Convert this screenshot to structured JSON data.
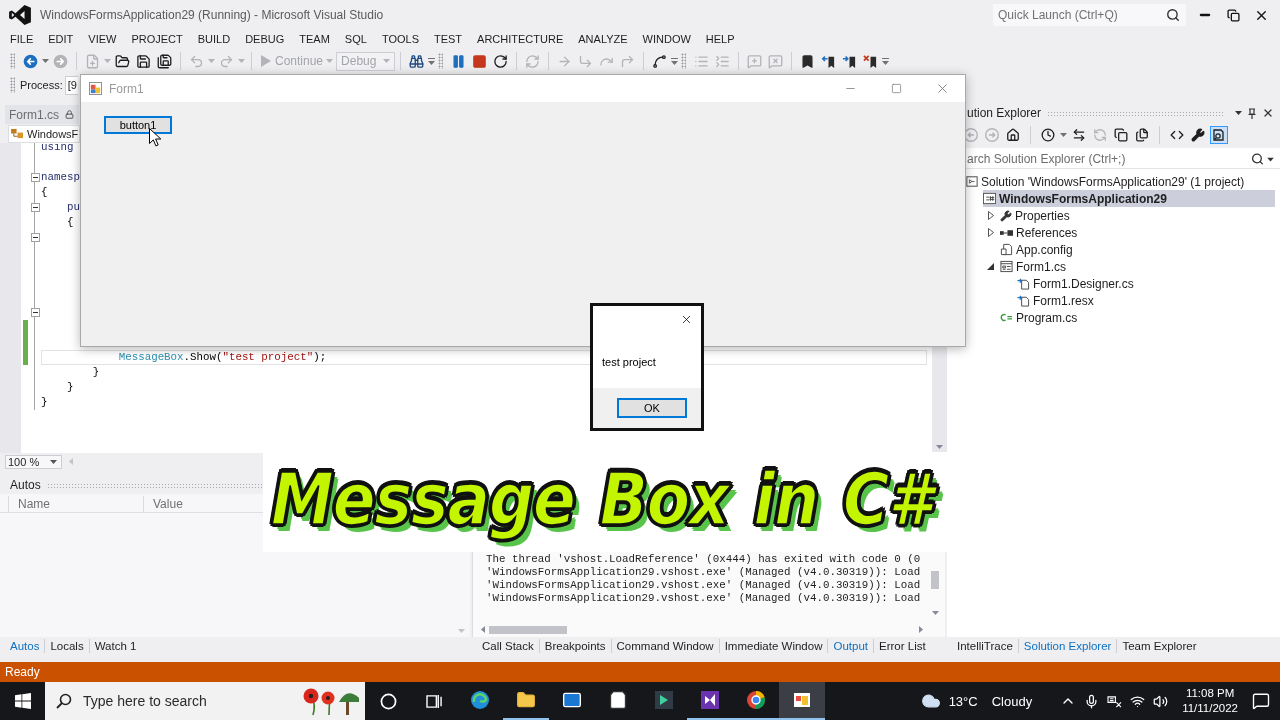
{
  "window": {
    "title": "WindowsFormsApplication29 (Running) - Microsoft Visual Studio"
  },
  "quick_launch": {
    "placeholder": "Quick Launch (Ctrl+Q)"
  },
  "menu": [
    "FILE",
    "EDIT",
    "VIEW",
    "PROJECT",
    "BUILD",
    "DEBUG",
    "TEAM",
    "SQL",
    "TOOLS",
    "TEST",
    "ARCHITECTURE",
    "ANALYZE",
    "WINDOW",
    "HELP"
  ],
  "toolbar": {
    "items": [
      {
        "kind": "button",
        "disabled": false
      },
      {
        "kind": "button",
        "disabled": true
      },
      {
        "kind": "button",
        "disabled": true
      },
      {
        "kind": "button",
        "disabled": false
      },
      {
        "kind": "button",
        "disabled": false
      },
      {
        "kind": "button",
        "disabled": false
      },
      {
        "kind": "button",
        "disabled": true
      },
      {
        "kind": "button",
        "disabled": true
      },
      {
        "kind": "labeled",
        "label": "Continue",
        "disabled": true
      },
      {
        "kind": "combo",
        "value": "Debug",
        "disabled": true
      },
      {
        "kind": "button",
        "disabled": false
      },
      {
        "kind": "button",
        "disabled": false
      },
      {
        "kind": "button",
        "disabled": false
      },
      {
        "kind": "button",
        "disabled": false
      },
      {
        "kind": "button",
        "disabled": true
      },
      {
        "kind": "button",
        "disabled": true
      },
      {
        "kind": "button",
        "disabled": true
      },
      {
        "kind": "button",
        "disabled": true
      },
      {
        "kind": "button",
        "disabled": true
      },
      {
        "kind": "button",
        "disabled": false
      },
      {
        "kind": "button",
        "disabled": true
      },
      {
        "kind": "button",
        "disabled": true
      },
      {
        "kind": "button",
        "disabled": true
      },
      {
        "kind": "button",
        "disabled": true
      },
      {
        "kind": "button",
        "disabled": false
      },
      {
        "kind": "button",
        "disabled": false
      },
      {
        "kind": "button",
        "disabled": false
      },
      {
        "kind": "button",
        "disabled": false
      }
    ]
  },
  "process_bar": {
    "label": "Process:",
    "value": "[9"
  },
  "editor": {
    "tab": "Form1.cs",
    "navigation": "WindowsF",
    "lines": [
      {
        "fold": false,
        "changed": false,
        "current": false,
        "tokens": [
          {
            "text": "using",
            "kind": "keyword"
          }
        ]
      },
      {
        "fold": false,
        "changed": false,
        "current": false
      },
      {
        "fold": true,
        "changed": false,
        "current": false,
        "tokens": [
          {
            "text": "namesp",
            "kind": "keyword"
          }
        ]
      },
      {
        "fold": false,
        "changed": false,
        "current": false,
        "tokens": [
          {
            "text": "{",
            "kind": "plain"
          }
        ]
      },
      {
        "fold": true,
        "changed": false,
        "current": false,
        "tokens": [
          {
            "text": "    pu",
            "kind": "keyword"
          }
        ]
      },
      {
        "fold": false,
        "changed": false,
        "current": false,
        "tokens": [
          {
            "text": "    {",
            "kind": "plain"
          }
        ]
      },
      {
        "fold": true,
        "changed": false,
        "current": false
      },
      {
        "fold": false,
        "changed": false,
        "current": false
      },
      {
        "fold": false,
        "changed": false,
        "current": false
      },
      {
        "fold": false,
        "changed": false,
        "current": false
      },
      {
        "fold": false,
        "changed": false,
        "current": false
      },
      {
        "fold": true,
        "changed": false,
        "current": false
      },
      {
        "fold": false,
        "changed": true,
        "current": false
      },
      {
        "fold": false,
        "changed": true,
        "current": false
      },
      {
        "fold": false,
        "changed": true,
        "current": true,
        "tokens": [
          {
            "text": "            MessageBox",
            "kind": "type"
          },
          {
            "text": ".Show(",
            "kind": "plain"
          },
          {
            "text": "\"test project\"",
            "kind": "string"
          },
          {
            "text": ");",
            "kind": "plain"
          }
        ]
      },
      {
        "fold": false,
        "changed": false,
        "current": false,
        "tokens": [
          {
            "text": "        }",
            "kind": "plain"
          }
        ]
      },
      {
        "fold": false,
        "changed": false,
        "current": false,
        "tokens": [
          {
            "text": "    }",
            "kind": "plain"
          }
        ]
      },
      {
        "fold": false,
        "changed": false,
        "current": false,
        "tokens": [
          {
            "text": "}",
            "kind": "plain"
          }
        ]
      }
    ],
    "zoom": "100 %"
  },
  "form_window": {
    "title": "Form1",
    "active": false,
    "button": {
      "label": "button1",
      "focused": true
    }
  },
  "message_box": {
    "text": "test project",
    "button": {
      "label": "OK",
      "focused": true
    }
  },
  "solution_explorer": {
    "title": "ution Explorer",
    "toolbar": [
      {
        "disabled": true,
        "on": false
      },
      {
        "disabled": true,
        "on": false
      },
      {
        "disabled": false,
        "on": false
      },
      {
        "disabled": false,
        "on": false
      },
      {
        "disabled": false,
        "on": false
      },
      {
        "disabled": true,
        "on": false
      },
      {
        "disabled": false,
        "on": false
      },
      {
        "disabled": false,
        "on": false
      },
      {
        "disabled": false,
        "on": false
      },
      {
        "disabled": false,
        "on": false
      },
      {
        "disabled": false,
        "on": true
      }
    ],
    "search": {
      "placeholder": "arch Solution Explorer (Ctrl+;)"
    },
    "tree": [
      {
        "kind": "solution",
        "label": "Solution 'WindowsFormsApplication29' (1 project)",
        "selected": false,
        "children": [
          {
            "kind": "project",
            "label": "WindowsFormsApplication29",
            "selected": true,
            "children": [
              {
                "kind": "properties",
                "label": "Properties",
                "selected": false,
                "expanded": false
              },
              {
                "kind": "references",
                "label": "References",
                "selected": false,
                "expanded": false
              },
              {
                "kind": "config",
                "label": "App.config",
                "selected": false
              },
              {
                "kind": "form",
                "label": "Form1.cs",
                "selected": false,
                "expanded": true,
                "children": [
                  {
                    "kind": "dependent",
                    "label": "Form1.Designer.cs",
                    "selected": false
                  },
                  {
                    "kind": "dependent",
                    "label": "Form1.resx",
                    "selected": false
                  }
                ]
              },
              {
                "kind": "csharp",
                "label": "Program.cs",
                "selected": false
              }
            ]
          }
        ]
      }
    ],
    "tabs": [
      {
        "label": "IntelliTrace",
        "selected": false
      },
      {
        "label": "Solution Explorer",
        "selected": true
      },
      {
        "label": "Team Explorer",
        "selected": false
      }
    ]
  },
  "banner": {
    "title": "Message Box in C#"
  },
  "autos": {
    "title": "Autos",
    "columns": [
      "Name",
      "Value"
    ],
    "tabs": [
      {
        "label": "Autos",
        "selected": true
      },
      {
        "label": "Locals",
        "selected": false
      },
      {
        "label": "Watch 1",
        "selected": false
      }
    ]
  },
  "output": {
    "lines": [
      "The thread 'vshost.LoadReference' (0x444) has exited with code 0 (0",
      "'WindowsFormsApplication29.vshost.exe' (Managed (v4.0.30319)): Load",
      "'WindowsFormsApplication29.vshost.exe' (Managed (v4.0.30319)): Load",
      "'WindowsFormsApplication29.vshost.exe' (Managed (v4.0.30319)): Load"
    ],
    "tabs": [
      {
        "label": "Call Stack",
        "selected": false
      },
      {
        "label": "Breakpoints",
        "selected": false
      },
      {
        "label": "Command Window",
        "selected": false
      },
      {
        "label": "Immediate Window",
        "selected": false
      },
      {
        "label": "Output",
        "selected": true
      },
      {
        "label": "Error List",
        "selected": false
      }
    ]
  },
  "status_bar": {
    "text": "Ready"
  },
  "taskbar": {
    "search": {
      "placeholder": "Type here to search"
    },
    "apps": [
      {
        "running": false,
        "active": false
      },
      {
        "running": true,
        "active": false
      },
      {
        "running": false,
        "active": false
      },
      {
        "running": false,
        "active": false
      },
      {
        "running": false,
        "active": false
      },
      {
        "running": true,
        "active": false
      },
      {
        "running": true,
        "active": false
      },
      {
        "running": true,
        "active": true
      }
    ],
    "weather": {
      "temperature": "13°C",
      "condition": "Cloudy"
    },
    "clock": {
      "time": "11:08 PM",
      "date": "11/11/2022"
    }
  }
}
